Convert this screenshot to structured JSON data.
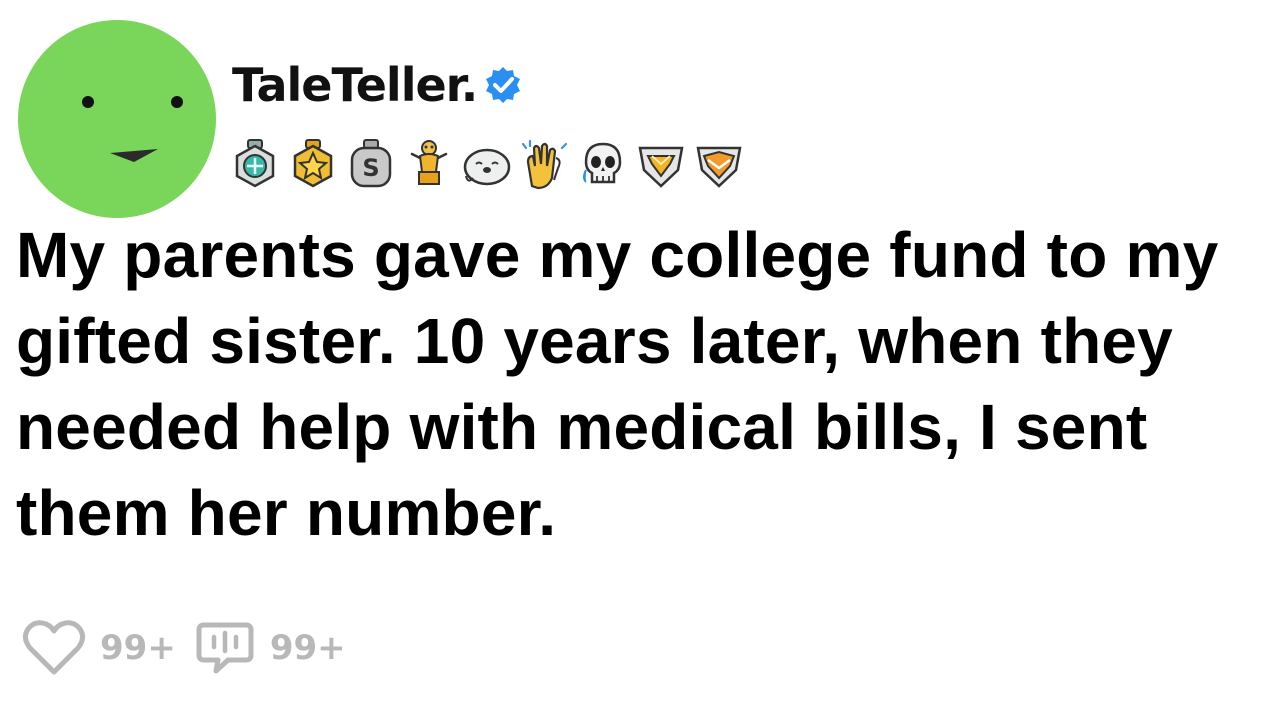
{
  "post": {
    "author": {
      "username": "TaleTeller.",
      "avatar_icon": "green-smiley-avatar-icon",
      "avatar_color": "#7ad65a",
      "verified_icon": "verified-badge-icon",
      "verified_color": "#2a8ff0"
    },
    "awards": [
      {
        "icon": "teal-gem-award-icon"
      },
      {
        "icon": "gold-star-award-icon"
      },
      {
        "icon": "silver-s-award-icon"
      },
      {
        "icon": "gold-trophy-award-icon"
      },
      {
        "icon": "seal-award-icon"
      },
      {
        "icon": "clapping-hands-award-icon"
      },
      {
        "icon": "crying-skull-award-icon"
      },
      {
        "icon": "gold-diamond-award-icon"
      },
      {
        "icon": "orange-chevron-award-icon"
      }
    ],
    "title": "My parents gave my college fund to my gifted sister. 10 years later, when they needed help with medical bills, I sent them her number.",
    "likes": "99+",
    "comments": "99+"
  }
}
